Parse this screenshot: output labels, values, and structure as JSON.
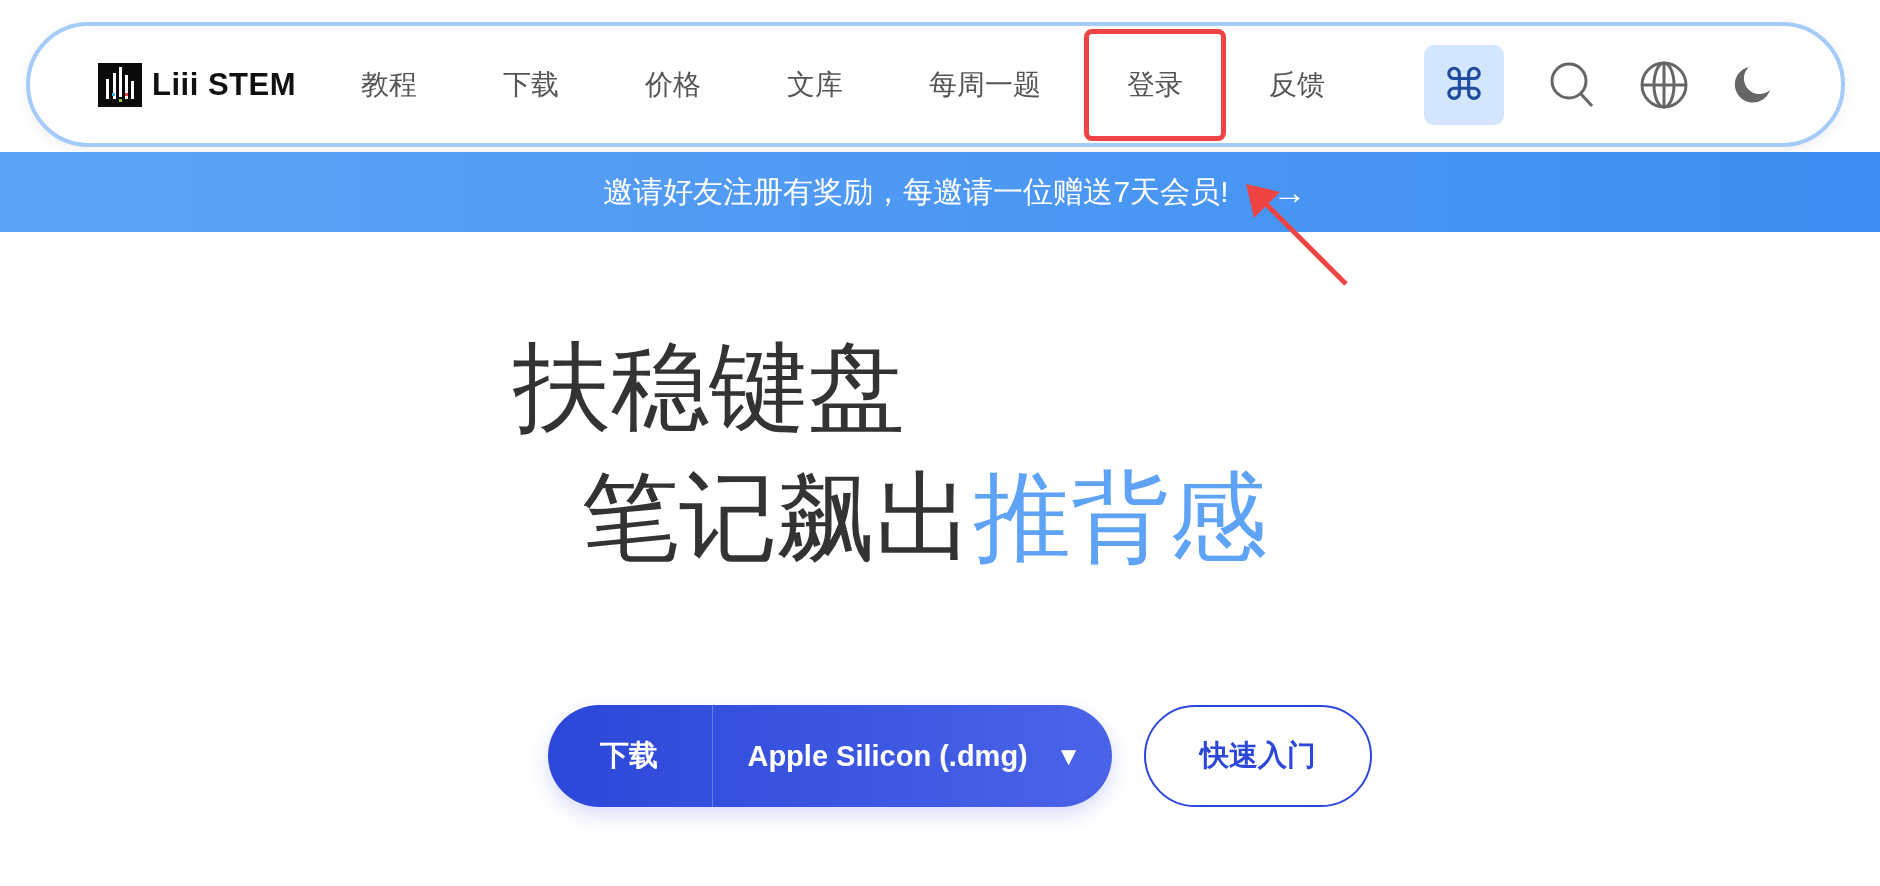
{
  "logo": {
    "text": "Liii STEM"
  },
  "nav": {
    "items": [
      {
        "label": "教程",
        "highlighted": false
      },
      {
        "label": "下载",
        "highlighted": false
      },
      {
        "label": "价格",
        "highlighted": false
      },
      {
        "label": "文库",
        "highlighted": false
      },
      {
        "label": "每周一题",
        "highlighted": false
      },
      {
        "label": "登录",
        "highlighted": true
      },
      {
        "label": "反馈",
        "highlighted": false
      }
    ],
    "command_button": {
      "symbol": "⌘"
    }
  },
  "annotation_arrow": true,
  "banner": {
    "text": "邀请好友注册有奖励，每邀请一位赠送7天会员!",
    "arrow": "→"
  },
  "hero": {
    "line_1": "扶稳键盘",
    "line_2": "笔记飙出",
    "line_2_accent": "推背感"
  },
  "download": {
    "label": "下载",
    "platform": "Apple Silicon (.dmg)",
    "caret": "▼"
  },
  "quick_start": {
    "label": "快速入门"
  }
}
